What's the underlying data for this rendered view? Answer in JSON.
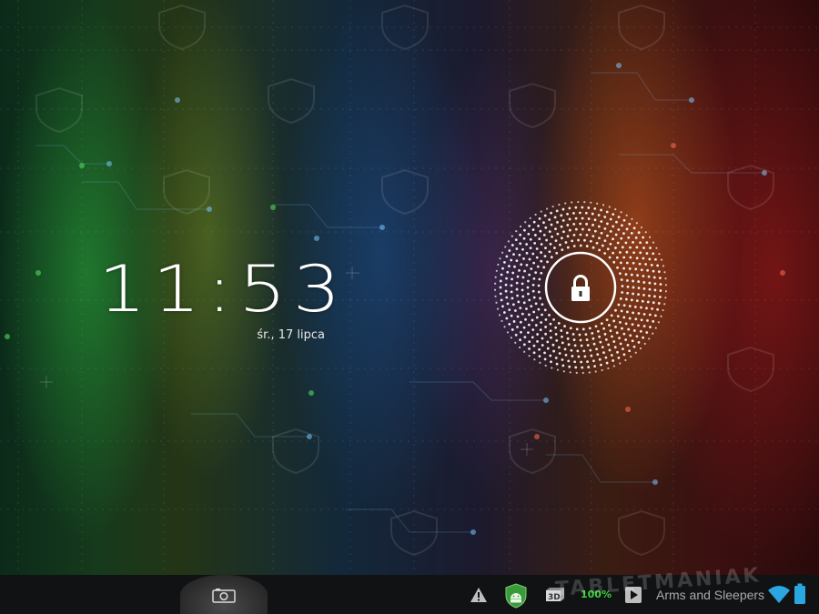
{
  "lockscreen": {
    "time": "11:53",
    "date": "śr., 17 lipca"
  },
  "unlock": {
    "icon": "lock-icon"
  },
  "navbar": {
    "camera_icon": "camera-icon"
  },
  "status_bar": {
    "warning_icon": "warning-icon",
    "shield_icon": "android-shield-icon",
    "app_icon": "3d-app-icon",
    "battery_percent": "100%",
    "play_icon": "play-icon",
    "media_title": "Arms and Sleepers",
    "wifi_icon": "wifi-icon",
    "battery_icon": "battery-icon"
  },
  "watermark": {
    "text": "TABLETMANIAK"
  },
  "colors": {
    "battery_green": "#3bd23b",
    "navbar_bg": "#111213",
    "wifi_blue": "#2aa6e0"
  }
}
